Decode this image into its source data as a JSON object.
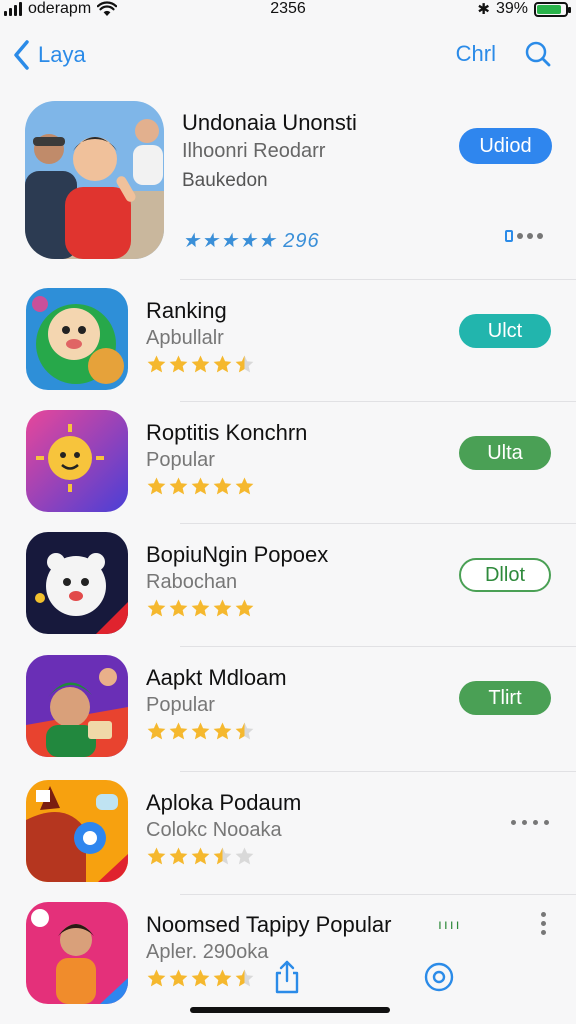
{
  "status_bar": {
    "carrier": "oderapm",
    "time": "2356",
    "battery_percent": "39%",
    "battery_level": 0.85,
    "icons": [
      "signal-icon",
      "wifi-icon",
      "bluetooth-icon",
      "battery-icon"
    ]
  },
  "nav": {
    "back_label": "Laya",
    "action_label": "Chrl",
    "icons": [
      "chevron-left-icon",
      "search-icon"
    ],
    "accent": "#2b8be8"
  },
  "featured": {
    "title": "Undonaia Unonsti",
    "subtitle": "Ilhoonri Reodarr",
    "meta": "Baukedon",
    "rating_text": "★★★★★ 296",
    "button_label": "Udiod",
    "button_color": "#2f86ee"
  },
  "apps": [
    {
      "title": "Ranking",
      "subtitle": "Apbullalr",
      "rating": 4.5,
      "button_label": "Ulct",
      "button_color": "#22b5ad",
      "action": "button"
    },
    {
      "title": "Roptitis Konchrn",
      "subtitle": "Popular",
      "rating": 5,
      "button_label": "Ulta",
      "button_color": "#4aa055",
      "action": "button"
    },
    {
      "title": "BopiuNgin Popoex",
      "subtitle": "Rabochan",
      "rating": 5,
      "button_label": "Dllot",
      "button_color": "#ffffff",
      "action": "outline"
    },
    {
      "title": "Aapkt Mdloam",
      "subtitle": "Popular",
      "rating": 4.5,
      "button_label": "Tlirt",
      "button_color": "#4aa055",
      "action": "button"
    },
    {
      "title": "Aploka Podaum",
      "subtitle": "Colokc Nooaka",
      "rating": 3.5,
      "button_label": "",
      "action": "more"
    },
    {
      "title": "Noomsed Tapipy Popular",
      "subtitle": "Apler. 290oka",
      "rating": 4.5,
      "button_label": "",
      "action": "more-vertical",
      "mini_label": "ıııı"
    }
  ],
  "bottom_bar": {
    "icons": [
      "share-icon",
      "compass-icon"
    ]
  },
  "colors": {
    "star_gold": "#f5b82e",
    "star_empty": "#d9d9d9"
  }
}
